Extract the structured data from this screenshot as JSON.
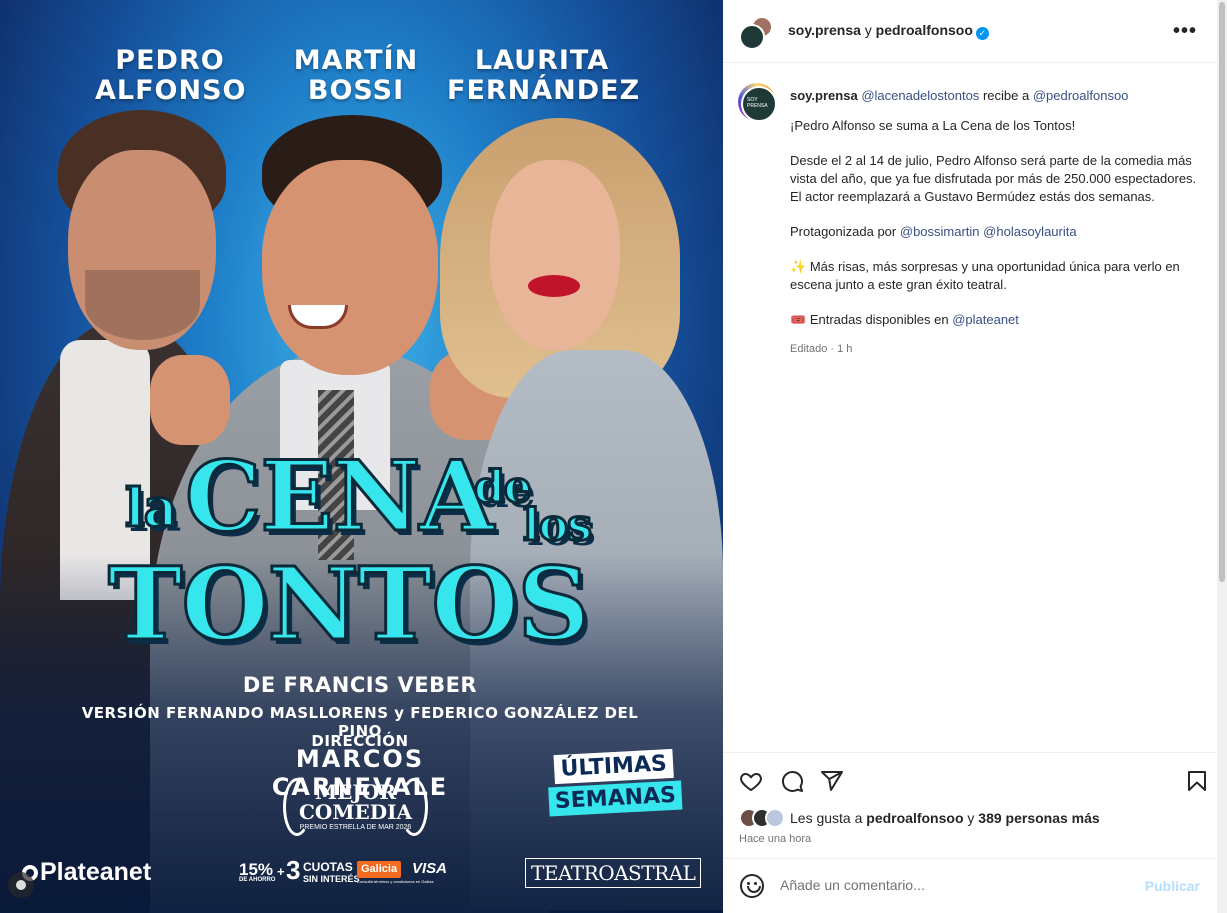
{
  "poster": {
    "actors": [
      {
        "first": "PEDRO",
        "last": "ALFONSO"
      },
      {
        "first": "MARTÍN",
        "last": "BOSSI"
      },
      {
        "first": "LAURITA",
        "last": "FERNÁNDEZ"
      }
    ],
    "title": {
      "la": "la",
      "cena": "CENA",
      "de": "de",
      "los": "los",
      "tontos": "TONTOS"
    },
    "author": "DE FRANCIS VEBER",
    "version": "VERSIÓN FERNANDO MASLLORENS y FEDERICO GONZÁLEZ DEL PINO",
    "direction_label": "DIRECCIÓN",
    "director": "MARCOS CARNEVALE",
    "award": {
      "line1": "MEJOR",
      "line2": "COMEDIA",
      "line3": "PREMIO ESTRELLA DE MAR 2026"
    },
    "badge": {
      "line1": "ÚLTIMAS",
      "line2": "SEMANAS"
    },
    "sponsors": {
      "plateanet": "Plateanet",
      "promo_pct": "15%",
      "promo_pct_sub": "DE AHORRO",
      "promo_cuotas_num": "3",
      "promo_cuotas": "CUOTAS",
      "promo_cuotas_sub": "SIN INTERÉS",
      "bank": "Galicia",
      "card": "VISA",
      "fineprint": "Consultá términos y condiciones en Galicia",
      "theater": "TEATROASTRAL"
    }
  },
  "header": {
    "user1": "soy.prensa",
    "joiner": "y",
    "user2": "pedroalfonsoo",
    "more": "•••"
  },
  "caption": {
    "avatar_text": "SOY PRENSA",
    "author": "soy.prensa",
    "mention1": "@lacenadelostontos",
    "mid": "recibe a",
    "mention2": "@pedroalfonsoo",
    "p1": "¡Pedro Alfonso se suma a La Cena de los Tontos!",
    "p2": "Desde el 2 al 14 de julio, Pedro Alfonso será parte de la comedia más vista del año, que ya fue disfrutada por más de 250.000 espectadores. El actor reemplazará a Gustavo Bermúdez estás dos semanas.",
    "p3_prefix": "Protagonizada por",
    "p3_m1": "@bossimartin",
    "p3_m2": "@holasoylaurita",
    "p4_emoji": "✨",
    "p4": "Más risas, más sorpresas y una oportunidad única para verlo en escena junto a este gran éxito teatral.",
    "p5_emoji": "🎟️",
    "p5_prefix": "Entradas disponibles en",
    "p5_mention": "@plateanet",
    "meta": "Editado · 1 h"
  },
  "actions": {
    "likes_prefix": "Les gusta a",
    "likes_user": "pedroalfonsoo",
    "likes_mid": "y",
    "likes_count": "389 personas más",
    "time": "Hace una hora"
  },
  "comment": {
    "placeholder": "Añade un comentario...",
    "publish": "Publicar"
  },
  "colors": {
    "accent_blue": "#0095f6",
    "mention": "#385185",
    "title_cyan": "#37e5ec"
  }
}
